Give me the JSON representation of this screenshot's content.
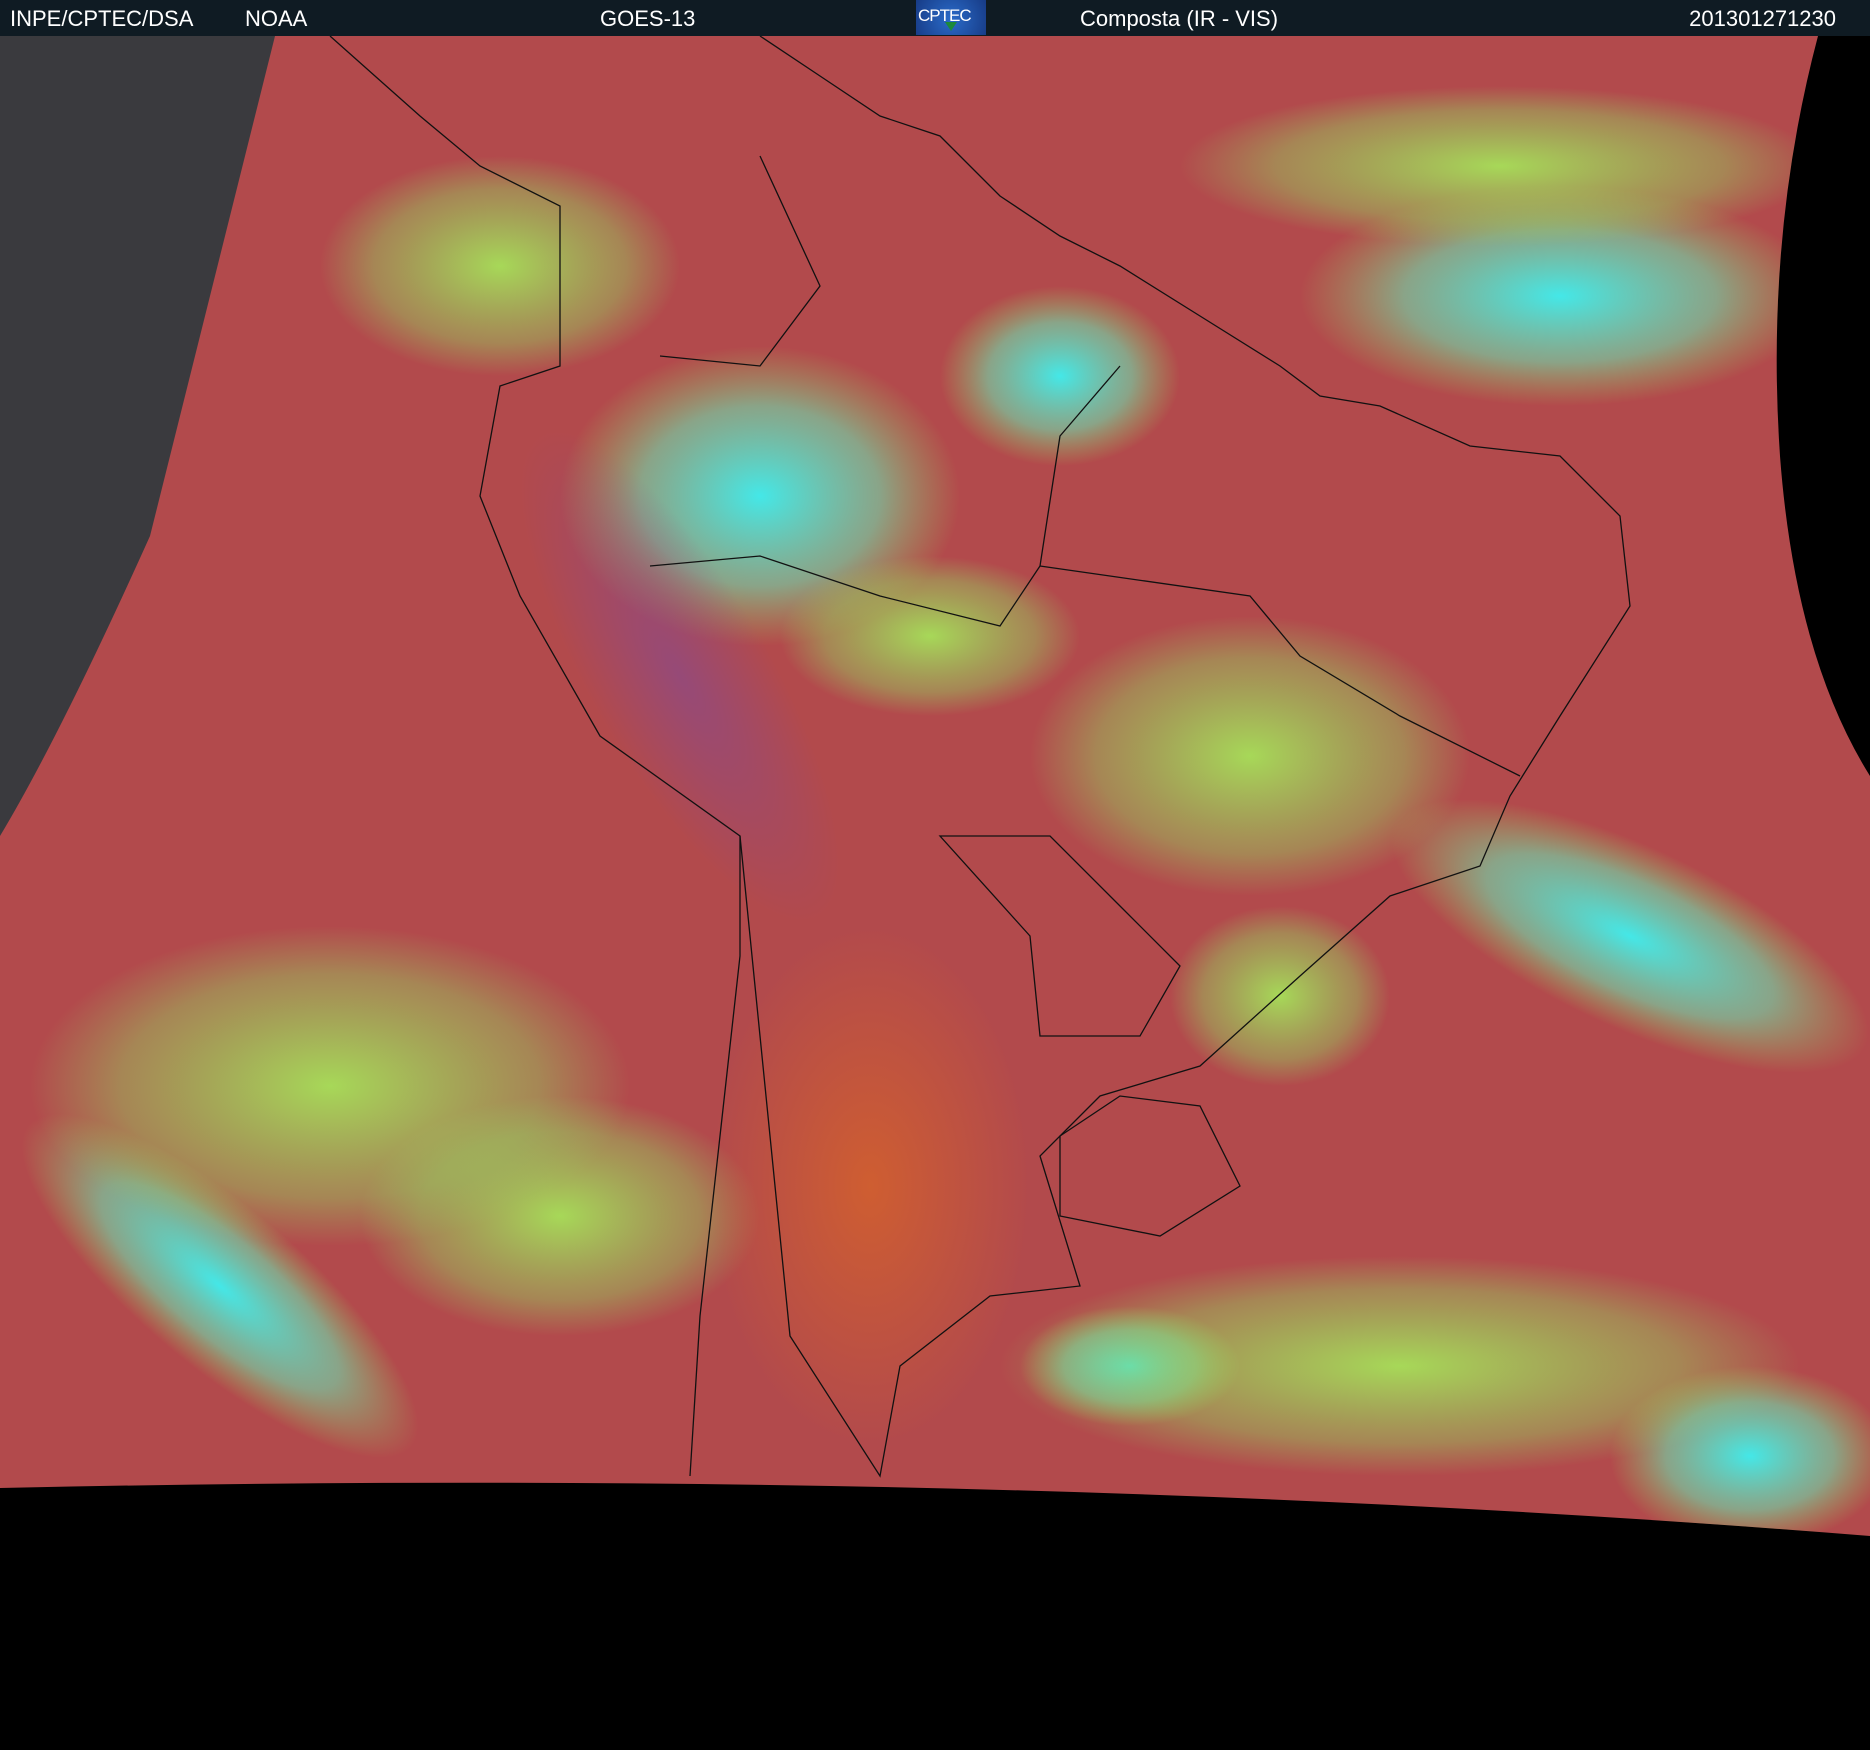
{
  "header": {
    "org": "INPE/CPTEC/DSA",
    "agency": "NOAA",
    "satellite": "GOES-13",
    "logo_text": "CPTEC",
    "product": "Composta (IR - VIS)",
    "timestamp": "201301271230"
  },
  "colors": {
    "header_bg": "#0f1b23",
    "ocean_clear": "#b24a4c",
    "land_clear": "#c25a3e",
    "low_cloud": "#9be05a",
    "high_cloud": "#3ef0f0",
    "space": "#000000"
  }
}
